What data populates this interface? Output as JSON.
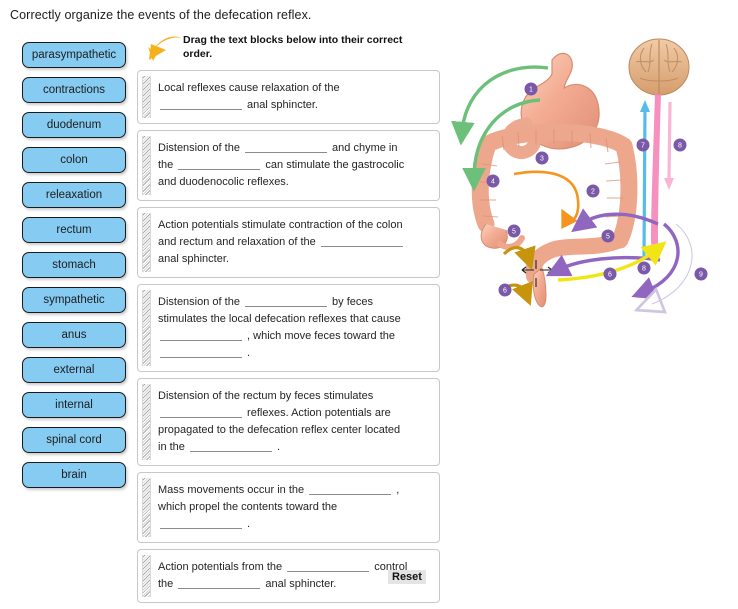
{
  "page_title": "Correctly organize the events of the defecation reflex.",
  "instruction": "Drag the text blocks below into their correct order.",
  "reset_label": "Reset",
  "word_bank": [
    {
      "label": "parasympathetic"
    },
    {
      "label": "contractions"
    },
    {
      "label": "duodenum"
    },
    {
      "label": "colon"
    },
    {
      "label": "releaxation"
    },
    {
      "label": "rectum"
    },
    {
      "label": "stomach"
    },
    {
      "label": "sympathetic"
    },
    {
      "label": "anus"
    },
    {
      "label": "external"
    },
    {
      "label": "internal"
    },
    {
      "label": "spinal cord"
    },
    {
      "label": "brain"
    }
  ],
  "blocks": [
    {
      "lines": [
        [
          {
            "t": "Local reflexes cause relaxation of the"
          }
        ],
        [
          {
            "blank": true
          },
          {
            "t": " anal sphincter."
          }
        ]
      ]
    },
    {
      "lines": [
        [
          {
            "t": "Distension of the "
          },
          {
            "blank": true
          },
          {
            "t": " and chyme in"
          }
        ],
        [
          {
            "t": "the "
          },
          {
            "blank": true
          },
          {
            "t": " can stimulate the gastrocolic"
          }
        ],
        [
          {
            "t": "and duodenocolic reflexes."
          }
        ]
      ]
    },
    {
      "lines": [
        [
          {
            "t": "Action potentials stimulate contraction of the colon"
          }
        ],
        [
          {
            "t": "and rectum and relaxation of the "
          },
          {
            "blank": true
          }
        ],
        [
          {
            "t": "anal sphincter."
          }
        ]
      ]
    },
    {
      "lines": [
        [
          {
            "t": "Distension of the "
          },
          {
            "blank": true
          },
          {
            "t": " by feces"
          }
        ],
        [
          {
            "t": "stimulates the local defecation reflexes that cause"
          }
        ],
        [
          {
            "blank": true
          },
          {
            "t": " , which move feces toward the"
          }
        ],
        [
          {
            "blank": true
          },
          {
            "t": " ."
          }
        ]
      ]
    },
    {
      "lines": [
        [
          {
            "t": "Distension of the rectum by feces stimulates"
          }
        ],
        [
          {
            "blank": true
          },
          {
            "t": " reflexes.  Action potentials are"
          }
        ],
        [
          {
            "t": "propagated to the defecation reflex center located"
          }
        ],
        [
          {
            "t": "in the "
          },
          {
            "blank": true
          },
          {
            "t": " ."
          }
        ]
      ]
    },
    {
      "lines": [
        [
          {
            "t": "Mass movements occur in the "
          },
          {
            "blank": true
          },
          {
            "t": " ,"
          }
        ],
        [
          {
            "t": "which propel the contents toward the"
          }
        ],
        [
          {
            "blank": true
          },
          {
            "t": " ."
          }
        ]
      ]
    },
    {
      "lines": [
        [
          {
            "t": "Action potentials from the "
          },
          {
            "blank": true
          },
          {
            "t": " control"
          }
        ],
        [
          {
            "t": "the "
          },
          {
            "blank": true
          },
          {
            "t": " anal sphincter."
          }
        ]
      ]
    }
  ],
  "figure": {
    "callouts": [
      "1",
      "2",
      "3",
      "4",
      "5",
      "6",
      "7",
      "8",
      "9"
    ],
    "colors": {
      "organ": "#f0a58c",
      "organ_light": "#f7c4ae",
      "green_arrow": "#6cc07a",
      "orange_arrow": "#f5951f",
      "purple_arrow": "#9166c0",
      "yellow_arrow": "#f2e516",
      "dark_yellow_arrow": "#c8930d",
      "pink_arrow": "#f484b8",
      "blue_arrow": "#56bdea",
      "white_arrow": "#ffffff",
      "callout_badge": "#7a5aa8",
      "brain": "#e8b58a"
    }
  }
}
